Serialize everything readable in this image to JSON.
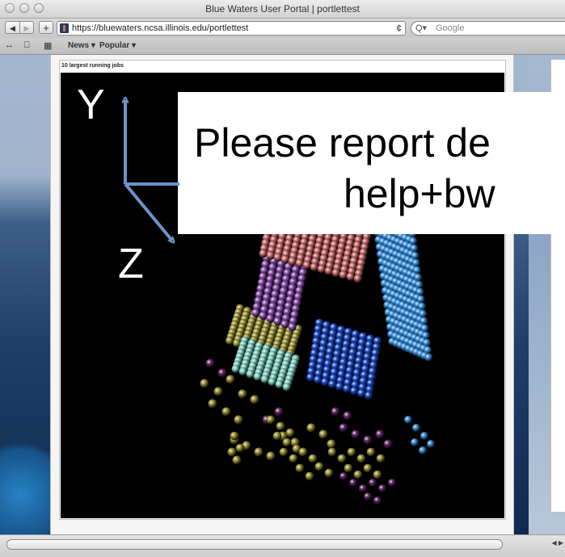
{
  "window": {
    "title": "Blue Waters User Portal | portlettest"
  },
  "toolbar": {
    "back_label": "◀",
    "forward_label": "▶",
    "add_label": "+",
    "url": "https://bluewaters.ncsa.illinois.edu/portlettest",
    "reload_label": "¢",
    "search_icon": "Q▾",
    "search_placeholder": "Google"
  },
  "bookmarks": {
    "reader_icon": "↔",
    "book_icon": "⎕",
    "grid_icon": "▦",
    "items": [
      {
        "label": "News ▾"
      },
      {
        "label": "Popular ▾"
      }
    ]
  },
  "portlet": {
    "title": "10 largest running jobs"
  },
  "axes": {
    "y_label": "Y",
    "z_label": "Z"
  },
  "callout": {
    "line1": "Please report de",
    "line2": "help+bw"
  },
  "colors": {
    "salmon": "#c96a6a",
    "purple": "#8d51b0",
    "blue": "#1d4fd0",
    "light_blue": "#3a8fdc",
    "olive": "#9b9433",
    "aqua": "#7fd0c0",
    "dark_purple": "#6a2870",
    "axis_arrow": "#6d93c8"
  },
  "scrollbar": {
    "arrows": "◀ ▶"
  }
}
